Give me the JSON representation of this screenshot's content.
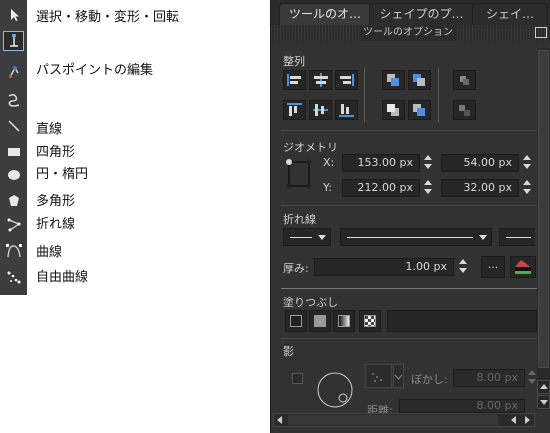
{
  "tool_legend": {
    "select": "選択・移動・変形・回転",
    "node": "パスポイントの編集",
    "line": "直線",
    "rect": "四角形",
    "ellipse": "円・楕円",
    "polygon": "多角形",
    "polyline": "折れ線",
    "curve": "曲線",
    "freehand": "自由曲線"
  },
  "tools": [
    "select-arrow-icon",
    "node-edit-icon",
    "path-point-icon",
    "spiral-icon",
    "line-icon",
    "rectangle-icon",
    "ellipse-icon",
    "polygon-icon",
    "polyline-icon",
    "bezier-curve-icon",
    "freehand-icon"
  ],
  "dock": {
    "tabs": [
      "ツールのオ…",
      "シェイプのプ…",
      "シェイ…"
    ],
    "title": "ツールのオプション",
    "align": {
      "label": "整列"
    },
    "geometry": {
      "label": "ジオメトリ",
      "x_label": "X:",
      "y_label": "Y:",
      "x_value": "153.00 px",
      "y_value": "212.00 px",
      "w_value": "54.00 px",
      "h_value": "32.00 px"
    },
    "stroke": {
      "label": "折れ線",
      "width_label": "厚み:",
      "width_value": "1.00 px",
      "more_label": "..."
    },
    "fill": {
      "label": "塗りつぶし"
    },
    "shadow": {
      "label": "影",
      "blur_label": "ぼかし:",
      "blur_value": "8.00 px",
      "distance_label": "距離:",
      "distance_value": "8.00 px"
    }
  }
}
